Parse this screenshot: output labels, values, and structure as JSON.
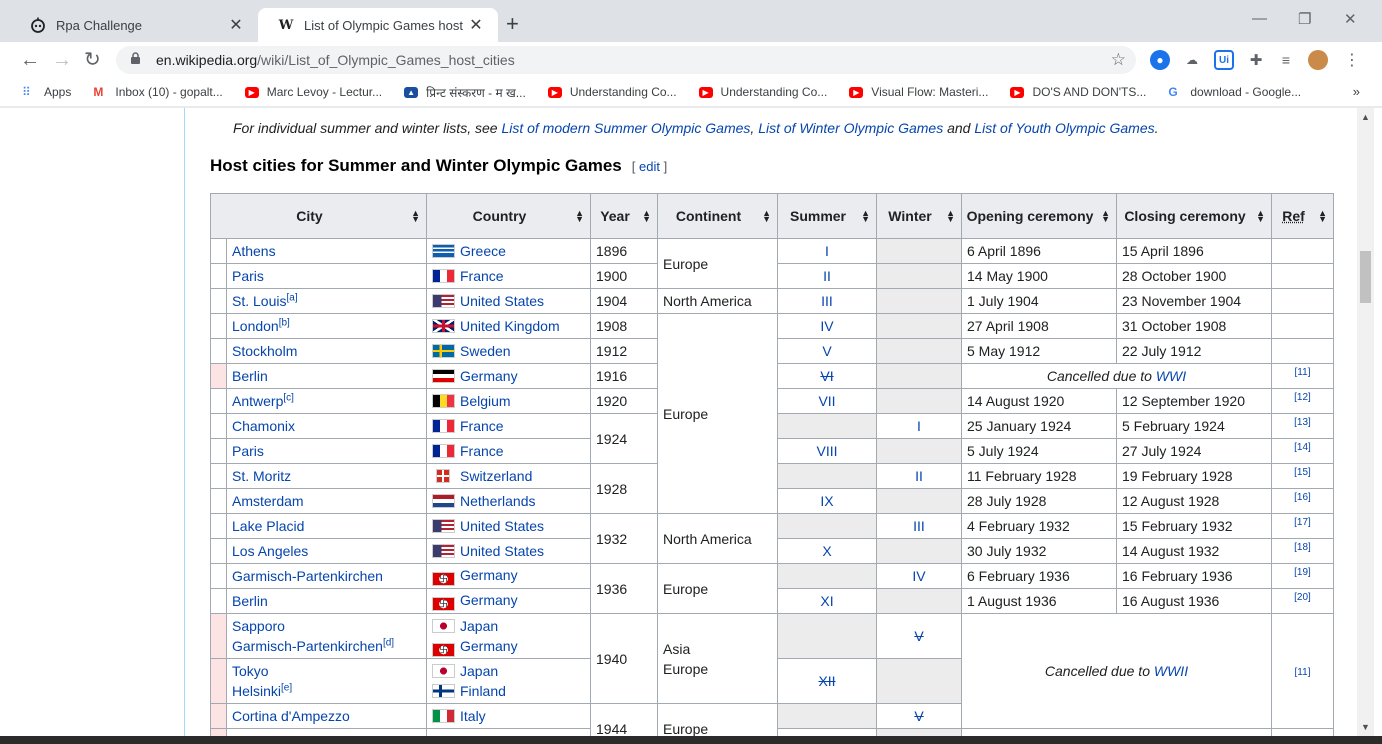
{
  "browser": {
    "tabs": [
      {
        "title": "Rpa Challenge",
        "favicon": "robot-icon"
      },
      {
        "title": "List of Olympic Games host citie",
        "favicon": "wikipedia-icon"
      }
    ],
    "url_domain": "en.wikipedia.org",
    "url_path": "/wiki/List_of_Olympic_Games_host_cities",
    "bookmarks": [
      {
        "label": "Apps",
        "icon": "apps-grid-icon",
        "color": "#4285f4"
      },
      {
        "label": "Inbox (10) - gopalt...",
        "icon": "gmail-icon",
        "color": "#ea4335"
      },
      {
        "label": "Marc Levoy - Lectur...",
        "icon": "youtube-icon",
        "color": "#ff0000"
      },
      {
        "label": "प्रिन्ट संस्करण - म ख...",
        "icon": "site-icon",
        "color": "#1a4fa0"
      },
      {
        "label": "Understanding Co...",
        "icon": "youtube-icon",
        "color": "#ff0000"
      },
      {
        "label": "Understanding Co...",
        "icon": "youtube-icon",
        "color": "#ff0000"
      },
      {
        "label": "Visual Flow: Masteri...",
        "icon": "youtube-icon",
        "color": "#ff0000"
      },
      {
        "label": "DO'S AND DON'TS...",
        "icon": "youtube-icon",
        "color": "#ff0000"
      },
      {
        "label": "download - Google...",
        "icon": "google-icon",
        "color": "#4285f4"
      }
    ]
  },
  "page": {
    "hatnote_prefix": "For individual summer and winter lists, see ",
    "hatnote_link1": "List of modern Summer Olympic Games",
    "hatnote_sep1": ", ",
    "hatnote_link2": "List of Winter Olympic Games",
    "hatnote_sep2": " and ",
    "hatnote_link3": "List of Youth Olympic Games",
    "hatnote_end": ".",
    "section_title": "Host cities for Summer and Winter Olympic Games",
    "edit_label": "edit",
    "columns": {
      "city": "City",
      "country": "Country",
      "year": "Year",
      "continent": "Continent",
      "summer": "Summer",
      "winter": "Winter",
      "opening": "Opening ceremony",
      "closing": "Closing ceremony",
      "ref": "Ref"
    },
    "rows": {
      "r1": {
        "city": "Athens",
        "country": "Greece",
        "year": "1896",
        "summer": "I",
        "open": "6 April 1896",
        "close": "15 April 1896"
      },
      "r2": {
        "city": "Paris",
        "country": "France",
        "year": "1900",
        "summer": "II",
        "open": "14 May 1900",
        "close": "28 October 1900"
      },
      "continent_1": "Europe",
      "r3": {
        "city": "St. Louis",
        "note": "[a]",
        "country": "United States",
        "year": "1904",
        "continent": "North America",
        "summer": "III",
        "open": "1 July 1904",
        "close": "23 November 1904"
      },
      "r4": {
        "city": "London",
        "note": "[b]",
        "country": "United Kingdom",
        "year": "1908",
        "summer": "IV",
        "open": "27 April 1908",
        "close": "31 October 1908"
      },
      "r5": {
        "city": "Stockholm",
        "country": "Sweden",
        "year": "1912",
        "summer": "V",
        "open": "5 May 1912",
        "close": "22 July 1912"
      },
      "r6": {
        "city": "Berlin",
        "country": "Germany",
        "year": "1916",
        "summer": "VI",
        "cancel_prefix": "Cancelled due to ",
        "cancel_link": "WWI",
        "ref": "[11]"
      },
      "r7": {
        "city": "Antwerp",
        "note": "[c]",
        "country": "Belgium",
        "year": "1920",
        "summer": "VII",
        "open": "14 August 1920",
        "close": "12 September 1920",
        "ref": "[12]"
      },
      "continent_2": "Europe",
      "r8": {
        "city": "Chamonix",
        "country": "France",
        "winter": "I",
        "open": "25 January 1924",
        "close": "5 February 1924",
        "ref": "[13]"
      },
      "year_1924": "1924",
      "r9": {
        "city": "Paris",
        "country": "France",
        "summer": "VIII",
        "open": "5 July 1924",
        "close": "27 July 1924",
        "ref": "[14]"
      },
      "r10": {
        "city": "St. Moritz",
        "country": "Switzerland",
        "winter": "II",
        "open": "11 February 1928",
        "close": "19 February 1928",
        "ref": "[15]"
      },
      "year_1928": "1928",
      "r11": {
        "city": "Amsterdam",
        "country": "Netherlands",
        "summer": "IX",
        "open": "28 July 1928",
        "close": "12 August 1928",
        "ref": "[16]"
      },
      "r12": {
        "city": "Lake Placid",
        "country": "United States",
        "winter": "III",
        "open": "4 February 1932",
        "close": "15 February 1932",
        "ref": "[17]"
      },
      "year_1932": "1932",
      "continent_3": "North America",
      "r13": {
        "city": "Los Angeles",
        "country": "United States",
        "summer": "X",
        "open": "30 July 1932",
        "close": "14 August 1932",
        "ref": "[18]"
      },
      "r14": {
        "city": "Garmisch-Partenkirchen",
        "country": "Germany",
        "winter": "IV",
        "open": "6 February 1936",
        "close": "16 February 1936",
        "ref": "[19]"
      },
      "year_1936": "1936",
      "continent_4": "Europe",
      "r15": {
        "city": "Berlin",
        "country": "Germany",
        "summer": "XI",
        "open": "1 August 1936",
        "close": "16 August 1936",
        "ref": "[20]"
      },
      "r16": {
        "city1": "Sapporo",
        "city2": "Garmisch-Partenkirchen",
        "note2": "[d]",
        "country1": "Japan",
        "country2": "Germany",
        "winter": "V"
      },
      "year_1940": "1940",
      "continent_5a": "Asia",
      "continent_5b": "Europe",
      "r17": {
        "city1": "Tokyo",
        "city2": "Helsinki",
        "note2": "[e]",
        "country1": "Japan",
        "country2": "Finland",
        "summer": "XII"
      },
      "cancel2_prefix": "Cancelled due to ",
      "cancel2_link": "WWII",
      "cancel2_ref": "[11]",
      "r18": {
        "city": "Cortina d'Ampezzo",
        "country": "Italy",
        "winter": "V"
      },
      "year_1944": "1944",
      "continent_6": "Europe"
    }
  },
  "colors": {
    "link": "#0645ad",
    "header_bg": "#eaecf0",
    "border": "#a2a9b1",
    "cancelled_marker": "#fce4e4",
    "empty_cell": "#ececec"
  }
}
